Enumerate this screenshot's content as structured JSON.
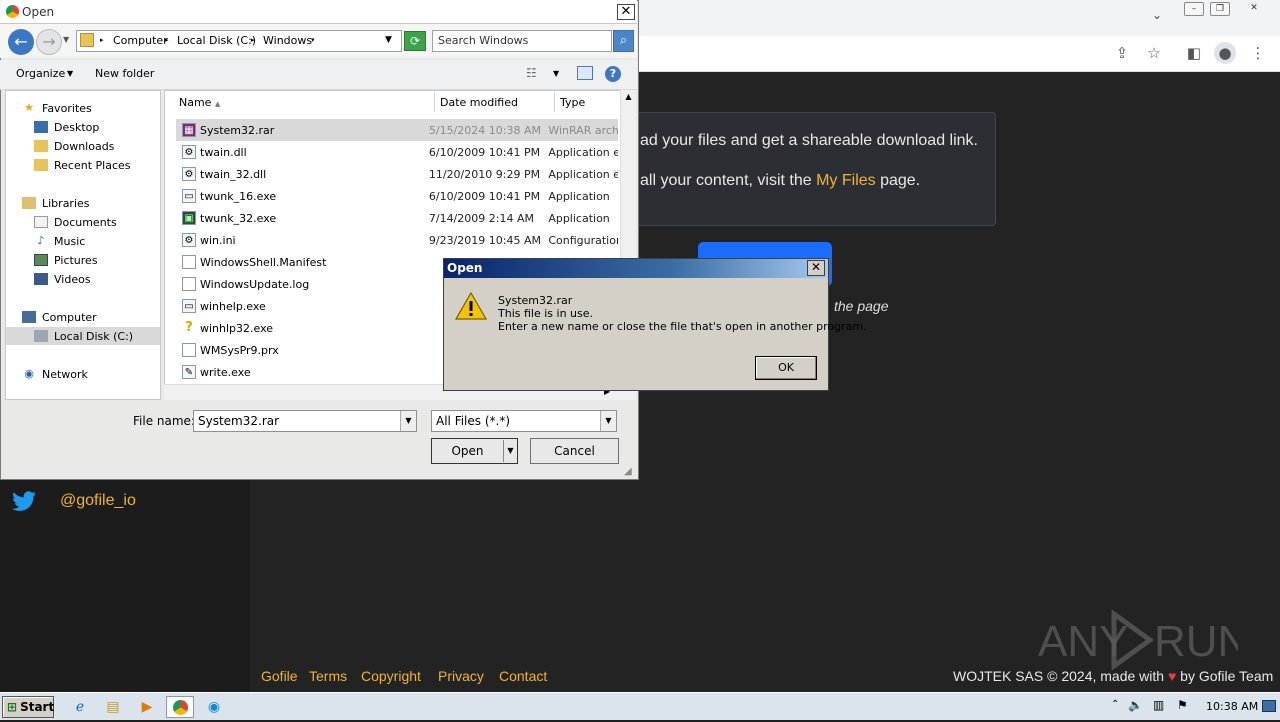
{
  "open_dialog": {
    "title": "Open",
    "breadcrumb": [
      "Computer",
      "Local Disk (C:)",
      "Windows"
    ],
    "search_placeholder": "Search Windows",
    "toolbar": {
      "organize": "Organize",
      "new_folder": "New folder"
    },
    "nav": {
      "favorites": "Favorites",
      "desktop": "Desktop",
      "downloads": "Downloads",
      "recent_places": "Recent Places",
      "libraries": "Libraries",
      "documents": "Documents",
      "music": "Music",
      "pictures": "Pictures",
      "videos": "Videos",
      "computer": "Computer",
      "local_disk": "Local Disk (C:)",
      "network": "Network"
    },
    "columns": {
      "name": "Name",
      "date_modified": "Date modified",
      "type": "Type"
    },
    "files": [
      {
        "name": "System32.rar",
        "date": "5/15/2024 10:38 AM",
        "type": "WinRAR archive",
        "icon": "rar-icon",
        "selected": true
      },
      {
        "name": "twain.dll",
        "date": "6/10/2009 10:41 PM",
        "type": "Application extension",
        "icon": "dll-icon"
      },
      {
        "name": "twain_32.dll",
        "date": "11/20/2010 9:29 PM",
        "type": "Application extension",
        "icon": "dll-icon"
      },
      {
        "name": "twunk_16.exe",
        "date": "6/10/2009 10:41 PM",
        "type": "Application",
        "icon": "exe-icon"
      },
      {
        "name": "twunk_32.exe",
        "date": "7/14/2009 2:14 AM",
        "type": "Application",
        "icon": "exe-icon"
      },
      {
        "name": "win.ini",
        "date": "9/23/2019 10:45 AM",
        "type": "Configuration settings",
        "icon": "ini-icon"
      },
      {
        "name": "WindowsShell.Manifest",
        "date": "",
        "type": "",
        "icon": "file-icon"
      },
      {
        "name": "WindowsUpdate.log",
        "date": "",
        "type": "",
        "icon": "file-icon"
      },
      {
        "name": "winhelp.exe",
        "date": "",
        "type": "",
        "icon": "exe-icon"
      },
      {
        "name": "winhlp32.exe",
        "date": "",
        "type": "",
        "icon": "help-icon"
      },
      {
        "name": "WMSysPr9.prx",
        "date": "",
        "type": "",
        "icon": "file-icon"
      },
      {
        "name": "write.exe",
        "date": "",
        "type": "",
        "icon": "write-icon"
      }
    ],
    "file_name_label": "File name:",
    "file_name_value": "System32.rar",
    "file_type_value": "All Files (*.*)",
    "open_label": "Open",
    "cancel_label": "Cancel"
  },
  "error_dialog": {
    "title": "Open",
    "line1": "System32.rar",
    "line2": "This file is in use.",
    "line3": "Enter a new name or close the file that's open in another program.",
    "ok_label": "OK"
  },
  "webpage": {
    "info_line1": "ad your files and get a shareable download link.",
    "info_line2_pre": "all your content, visit the ",
    "info_line2_link": "My Files",
    "info_line2_post": " page.",
    "page_note": "the page",
    "twitter_handle": "@gofile_io",
    "footer_links": [
      "Gofile",
      "Terms",
      "Copyright",
      "Privacy",
      "Contact"
    ],
    "footer_right_pre": "WOJTEK SAS © 2024, made with ",
    "footer_right_post": " by Gofile Team",
    "watermark": "ANY RUN"
  },
  "taskbar": {
    "start_label": "Start",
    "clock": "10:38 AM"
  },
  "colors": {
    "accent": "#f0b429",
    "page_bg": "#232323",
    "error_title": "#0a246a",
    "primary_button": "#1a6dff"
  }
}
